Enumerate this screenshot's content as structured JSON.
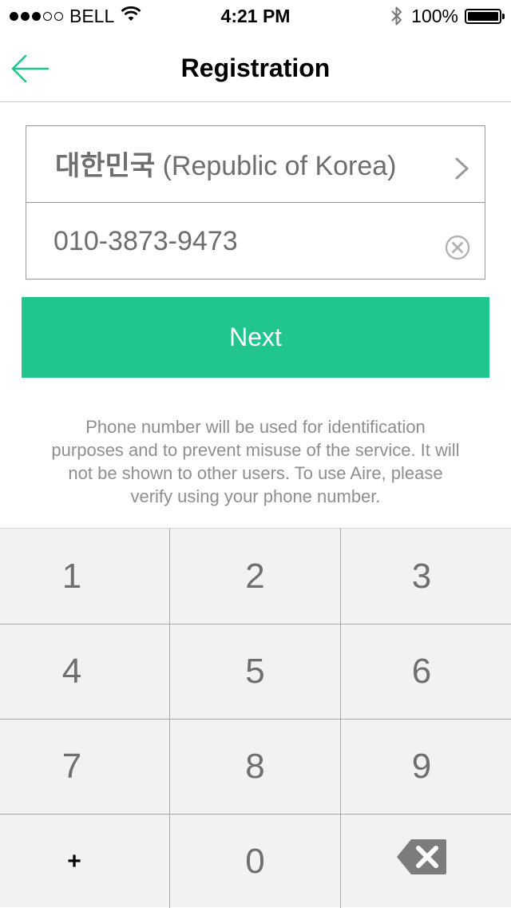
{
  "status_bar": {
    "signal_bars_filled": 3,
    "signal_bars_total": 5,
    "carrier": "BELL",
    "time": "4:21 PM",
    "battery_percent": "100%",
    "battery_level": 1.0,
    "icons": [
      "wifi-icon",
      "bluetooth-icon",
      "battery-icon"
    ]
  },
  "nav": {
    "title": "Registration",
    "back_icon": "arrow-left-icon"
  },
  "form": {
    "country_native": "대한민국",
    "country_english": "(Republic of Korea)",
    "chevron_icon": "chevron-right-icon",
    "phone_value": "010-3873-9473",
    "clear_icon": "clear-circle-icon"
  },
  "next_button": {
    "label": "Next"
  },
  "info": {
    "text": "Phone number will be used for identification purposes and to prevent misuse of the service. It will not be shown to other users. To use Aire, please verify using your phone number."
  },
  "keypad": {
    "keys": [
      "1",
      "2",
      "3",
      "4",
      "5",
      "6",
      "7",
      "8",
      "9",
      "+",
      "0"
    ],
    "delete_icon": "backspace-icon"
  },
  "colors": {
    "accent": "#20c68e",
    "text_gray": "#6e6e6e",
    "keypad_bg": "#f2f2f2"
  }
}
